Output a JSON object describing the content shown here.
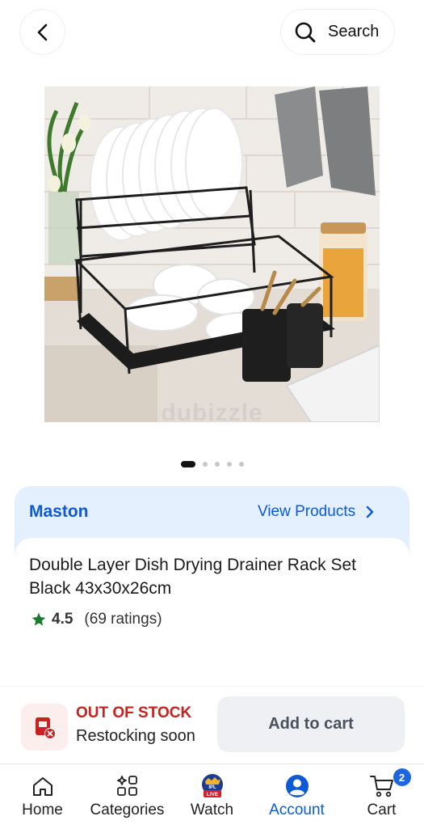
{
  "header": {
    "search_label": "Search"
  },
  "product": {
    "image_alt": "Double layer black dish drying rack with white plates and bowls",
    "watermark": "dubizzle",
    "carousel": {
      "count": 5,
      "active": 1
    },
    "brand": "Maston",
    "view_products_label": "View Products",
    "title": "Double Layer Dish Drying Drainer Rack Set Black 43x30x26cm",
    "rating_value": "4.5",
    "rating_count": "(69 ratings)"
  },
  "stock": {
    "status": "OUT OF STOCK",
    "note": "Restocking soon",
    "add_to_cart_label": "Add to cart"
  },
  "nav": {
    "items": [
      {
        "label": "Home",
        "icon": "home-icon"
      },
      {
        "label": "Categories",
        "icon": "categories-icon"
      },
      {
        "label": "Watch",
        "icon": "ipl-live-icon"
      },
      {
        "label": "Account",
        "icon": "account-icon"
      },
      {
        "label": "Cart",
        "icon": "cart-icon"
      }
    ],
    "active": "Account",
    "cart_count": "2",
    "watch_badge": "LIVE"
  },
  "colors": {
    "accent": "#0d5ad6",
    "out_of_stock": "#c9211e",
    "rating_star": "#1b7a2b",
    "brand_card": "#e4f0fd"
  }
}
